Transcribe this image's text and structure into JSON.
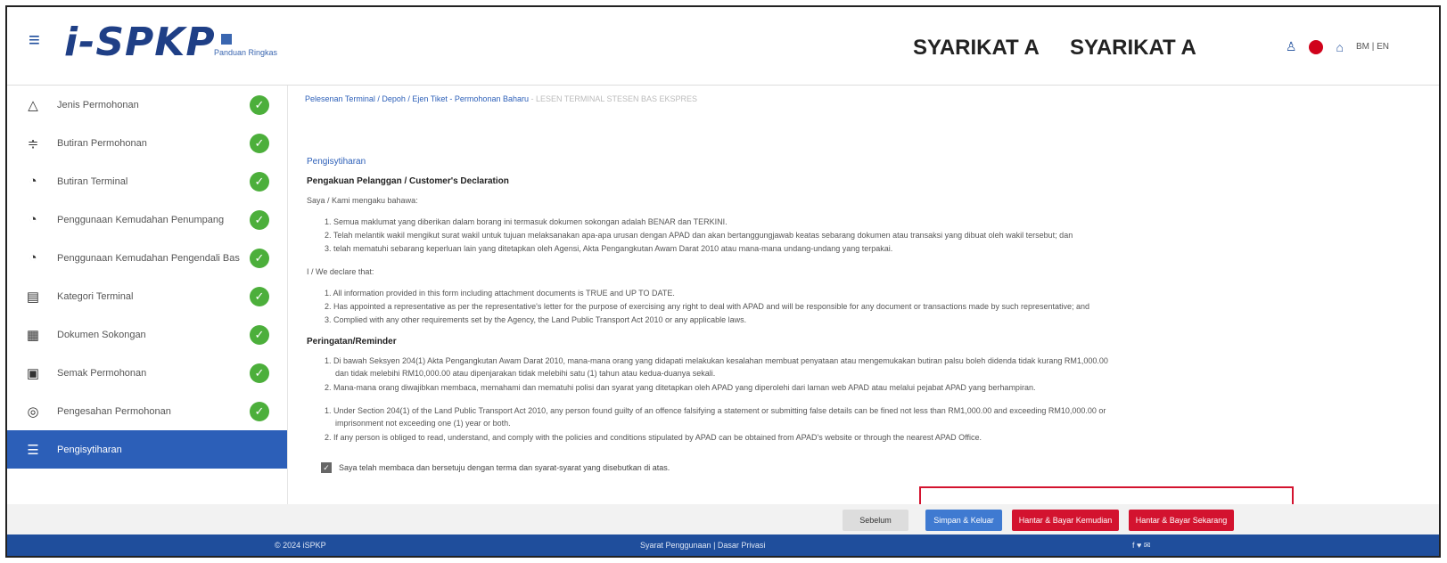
{
  "header": {
    "logo": "i-SPKP",
    "logo_sub": "Panduan Ringkas",
    "company1": "SYARIKAT A",
    "company2": "SYARIKAT A",
    "lang": "BM | EN"
  },
  "sidebar": {
    "items": [
      {
        "label": "Jenis Permohonan",
        "icon": "warning-triangle-icon",
        "done": true
      },
      {
        "label": "Butiran Permohonan",
        "icon": "filter-icon",
        "done": true
      },
      {
        "label": "Butiran Terminal",
        "icon": "gauge-icon",
        "done": true
      },
      {
        "label": "Penggunaan Kemudahan Penumpang",
        "icon": "gauge-icon",
        "done": true
      },
      {
        "label": "Penggunaan Kemudahan Pengendali Bas",
        "icon": "gauge-icon",
        "done": true
      },
      {
        "label": "Kategori Terminal",
        "icon": "document-icon",
        "done": true
      },
      {
        "label": "Dokumen Sokongan",
        "icon": "folder-icon",
        "done": true
      },
      {
        "label": "Semak Permohonan",
        "icon": "preview-icon",
        "done": true
      },
      {
        "label": "Pengesahan Permohonan",
        "icon": "verify-icon",
        "done": true
      },
      {
        "label": "Pengisytiharan",
        "icon": "list-icon",
        "done": false,
        "active": true
      }
    ]
  },
  "breadcrumb": {
    "path": "Pelesenan Terminal / Depoh / Ejen Tiket - Permohonan Baharu",
    "muted": " - LESEN TERMINAL STESEN BAS EKSPRES"
  },
  "declaration": {
    "section_title": "Pengisytiharan",
    "heading": "Pengakuan Pelanggan / Customer's Declaration",
    "intro_bm": "Saya / Kami mengaku bahawa:",
    "items_bm": [
      "1. Semua maklumat yang diberikan dalam borang ini termasuk dokumen sokongan adalah BENAR dan TERKINI.",
      "2. Telah melantik wakil mengikut surat wakil untuk tujuan melaksanakan apa-apa urusan dengan APAD dan akan bertanggungjawab keatas sebarang dokumen atau transaksi yang dibuat oleh wakil tersebut; dan",
      "3. telah mematuhi sebarang keperluan lain yang ditetapkan oleh Agensi, Akta Pengangkutan Awam Darat 2010 atau mana-mana undang-undang yang terpakai."
    ],
    "intro_en": "I / We declare that:",
    "items_en": [
      "1. All information provided in this form including attachment documents is TRUE and UP TO DATE.",
      "2. Has appointed a representative as per the representative's letter for the purpose of exercising any right to deal with APAD and will be responsible for any document or transactions made by such representative; and",
      "3. Complied with any other requirements set by the Agency, the Land Public Transport Act 2010 or any applicable laws."
    ],
    "reminder_heading": "Peringatan/Reminder",
    "reminder_bm": [
      "1. Di bawah Seksyen 204(1) Akta Pengangkutan Awam Darat 2010, mana-mana orang yang didapati melakukan kesalahan membuat penyataan atau mengemukakan butiran palsu boleh didenda tidak kurang RM1,000.00",
      "dan tidak melebihi RM10,000.00 atau dipenjarakan tidak melebihi satu (1) tahun atau kedua-duanya sekali.",
      "2. Mana-mana orang diwajibkan membaca, memahami dan mematuhi polisi dan syarat yang ditetapkan oleh APAD yang diperolehi dari laman web APAD atau melalui pejabat APAD yang berhampiran."
    ],
    "reminder_en": [
      "1. Under Section 204(1) of the Land Public Transport Act 2010, any person found guilty of an offence falsifying a statement or submitting false details can be fined not less than RM1,000.00 and exceeding RM10,000.00 or",
      "imprisonment not exceeding one (1) year or both.",
      "2. If any person is obliged to read, understand, and comply with the policies and conditions stipulated by APAD can be obtained from APAD's website or through the nearest APAD Office."
    ],
    "agree_label": "Saya telah membaca dan bersetuju dengan terma dan syarat-syarat yang disebutkan di atas."
  },
  "buttons": {
    "prev": "Sebelum",
    "save": "Simpan & Keluar",
    "pay_later": "Hantar & Bayar Kemudian",
    "pay_now": "Hantar & Bayar Sekarang"
  },
  "footer": {
    "copyright": "© 2024 iSPKP",
    "links": "Syarat Penggunaan | Dasar Privasi",
    "social": "f ♥ ✉"
  },
  "colors": {
    "primary": "#2c5fb8",
    "danger": "#d3132f",
    "success": "#4caf3b",
    "footer": "#1f4e9c"
  }
}
